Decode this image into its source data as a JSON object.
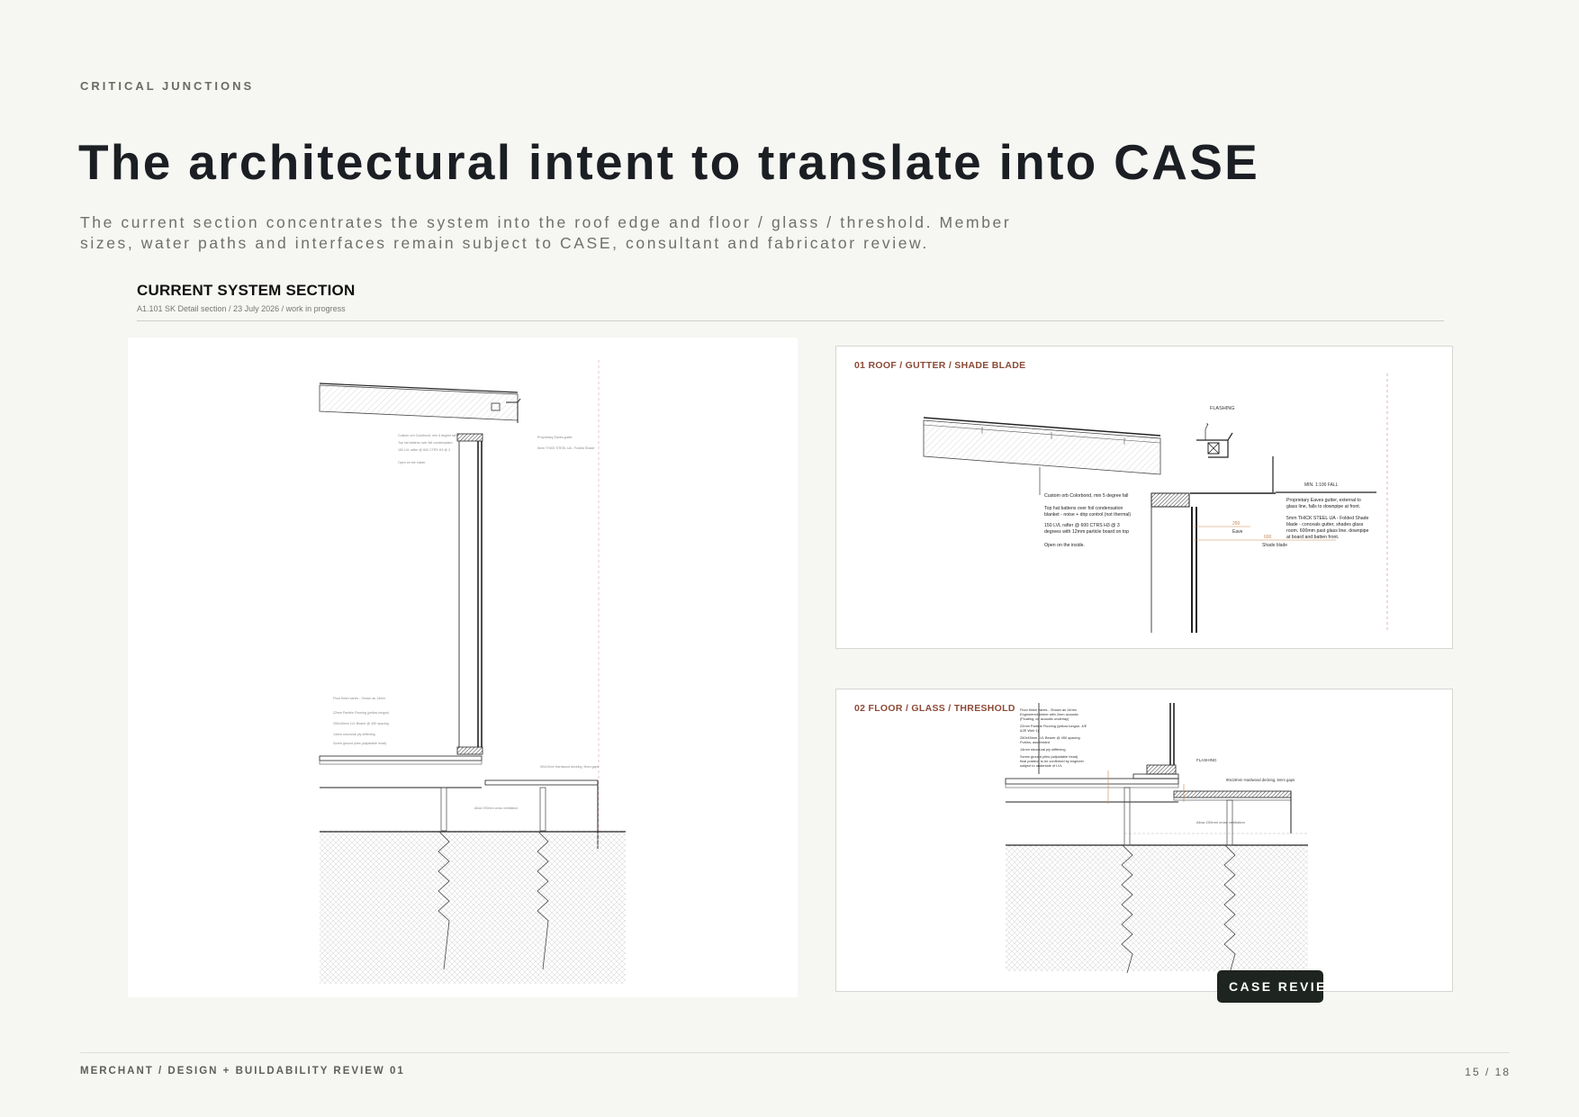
{
  "eyebrow": "CRITICAL JUNCTIONS",
  "title": "The architectural intent to translate into CASE",
  "lead": "The current section concentrates the system into the roof edge and floor / glass / threshold. Member sizes, water paths and interfaces remain subject to CASE, consultant and fabricator review.",
  "section": {
    "title": "CURRENT SYSTEM SECTION",
    "subtitle": "A1.101 SK Detail section / 23 July 2026 / work in progress"
  },
  "detail_roof": {
    "label": "01  ROOF / GUTTER / SHADE BLADE",
    "flashing": "FLASHING",
    "fall": "MIN. 1:100 FALL",
    "roof_note_1": "Custom orb Colorbond, min 5 degree fall",
    "roof_note_2a": "Top hat battens over foil condensation",
    "roof_note_2b": "blanket - noise + drip control (not thermal)",
    "roof_note_3a": "150 LVL rafter @ 600 CTRS H3 @ 3",
    "roof_note_3b": "degrees with 12mm particle board on top",
    "roof_note_4": "Open on the inside.",
    "gutter_note_a": "Proprietary Eaves gutter, external to",
    "gutter_note_b": "glass line, falls to downpipe at front.",
    "blade_note_a": "5mm THICK STEEL UA - Folded Shade",
    "blade_note_b": "blade - conceals gutter, shades glass",
    "blade_note_c": "room. 600mm past glass line. downpipe",
    "blade_note_d": "at board and batten front.",
    "dim_eave_value": "250",
    "dim_eave_label": "Eave",
    "dim_blade_value": "600",
    "dim_blade_label": "Shade blade"
  },
  "detail_floor": {
    "label": "02  FLOOR / GLASS / THRESHOLD",
    "flashing": "FLASHING",
    "deck_note": "90x19mm Hardwood decking, 5mm gaps",
    "ground_note": "Allow 200mm cross ventilation",
    "floor_note_1a": "Floor finish varies - Shown as 14mm",
    "floor_note_1b": "Engineered timber with 2mm acoustic",
    "floor_note_1c": "(Floating, on acoustic underlay)",
    "floor_note_2a": "22mm Particle Flooring (yellow tongue, 4/E",
    "floor_note_2b": "&2E Web 1)",
    "floor_note_3a": "250x45mm LVL Bearer @ 450 spacing",
    "floor_note_3b": "Purlins, assembled",
    "floor_note_4": "14mm structural ply stiffening",
    "floor_note_5a": "Screw ground piles (adjustable head)",
    "floor_note_5b": "final position to be confirmed by engineer",
    "floor_note_5c": "subject to underside of LVL"
  },
  "badge": "CASE REVIEW",
  "footer": {
    "left": "MERCHANT / DESIGN + BUILDABILITY REVIEW 01",
    "page": "15 / 18"
  },
  "colors": {
    "background": "#f6f6f2",
    "heading": "#1b1e23",
    "detail_label": "#8c4a36",
    "dimension": "#c9884e",
    "badge_bg": "#1e2420"
  }
}
